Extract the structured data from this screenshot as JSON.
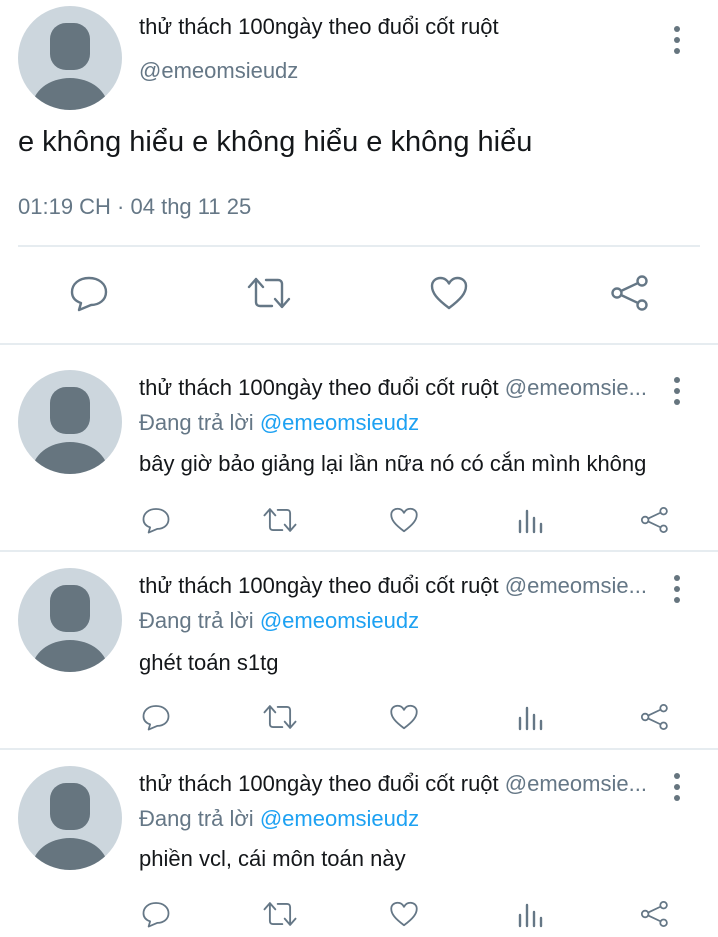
{
  "main_tweet": {
    "author_name": "thử thách 100ngày theo đuổi cốt ruột",
    "handle": "@emeomsieudz",
    "text": "e không hiểu e không hiểu e không hiểu",
    "timestamp": "01:19 CH · 04 thg 11 25"
  },
  "replies": [
    {
      "author_name": "thử thách 100ngày theo đuổi cốt ruột",
      "handle": "@emeomsie...",
      "replying_prefix": "Đang trả lời",
      "replying_to": "@emeomsieudz",
      "text": "bây giờ bảo giảng lại lần nữa nó có cắn mình không"
    },
    {
      "author_name": "thử thách 100ngày theo đuổi cốt ruột",
      "handle": "@emeomsie...",
      "replying_prefix": "Đang trả lời",
      "replying_to": "@emeomsieudz",
      "text": "ghét toán s1tg"
    },
    {
      "author_name": "thử thách 100ngày theo đuổi cốt ruột",
      "handle": "@emeomsie...",
      "replying_prefix": "Đang trả lời",
      "replying_to": "@emeomsieudz",
      "text": "phiền vcl, cái môn toán này"
    }
  ],
  "icons": {
    "reply": "reply-icon",
    "retweet": "retweet-icon",
    "like": "heart-icon",
    "analytics": "analytics-icon",
    "share": "share-icon",
    "more": "more-vertical-icon"
  },
  "colors": {
    "link": "#1da1f2",
    "secondary_text": "#657786",
    "divider": "#e6ecf0",
    "avatar_bg": "#ccd6dd",
    "avatar_fg": "#66757f"
  }
}
